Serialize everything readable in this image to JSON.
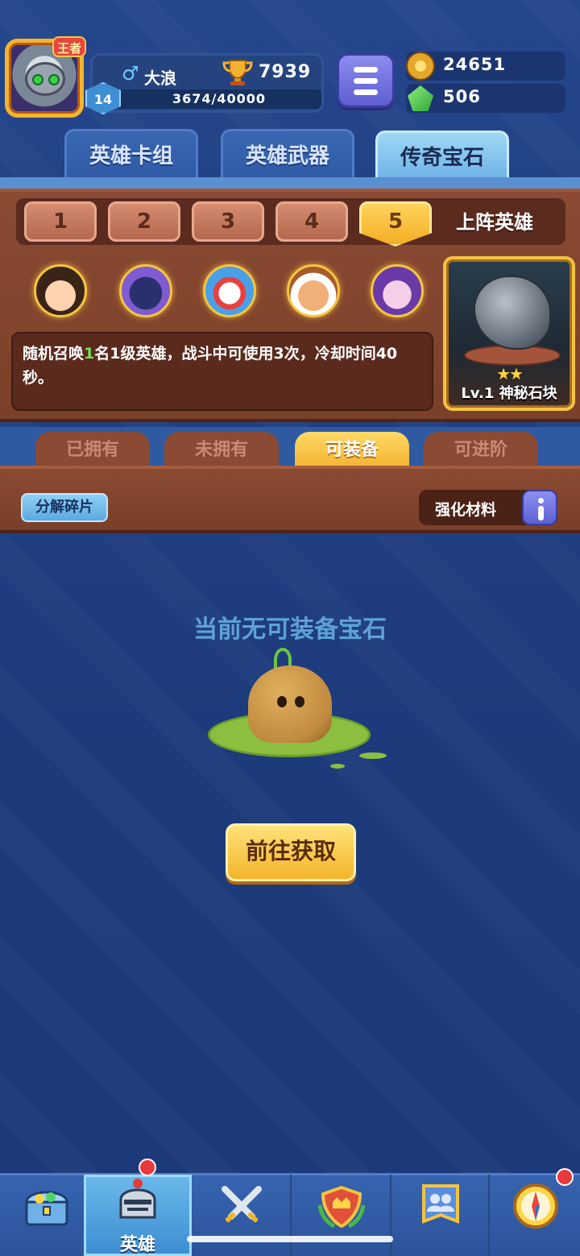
{
  "player": {
    "name": "大浪",
    "gender_symbol": "♂",
    "level": "14",
    "trophies": "7939",
    "xp": "3674/40000",
    "avatar_badge": "王者"
  },
  "currency": {
    "gold": "24651",
    "gems": "506"
  },
  "main_tabs": [
    {
      "label": "英雄卡组",
      "active": false
    },
    {
      "label": "英雄武器",
      "active": false
    },
    {
      "label": "传奇宝石",
      "active": true
    }
  ],
  "deck": {
    "slots": [
      "1",
      "2",
      "3",
      "4",
      "5"
    ],
    "active_slot": "5",
    "label": "上阵英雄"
  },
  "heroes": [
    {
      "icon": "hero-ninja-icon"
    },
    {
      "icon": "hero-knight-icon"
    },
    {
      "icon": "hero-clown-icon"
    },
    {
      "icon": "hero-chef-icon"
    },
    {
      "icon": "hero-mage-icon"
    }
  ],
  "description": {
    "part1": "随机召唤",
    "highlight": "1",
    "part2": "名1级英雄，战斗中可使用3次，冷却时间40秒。"
  },
  "gem_card": {
    "stars": "★★",
    "name": "Lv.1 神秘石块"
  },
  "filter_tabs": [
    {
      "label": "已拥有",
      "active": false
    },
    {
      "label": "未拥有",
      "active": false
    },
    {
      "label": "可装备",
      "active": true
    },
    {
      "label": "可进阶",
      "active": false
    }
  ],
  "toolbar": {
    "decompose_label": "分解碎片",
    "material_label": "强化材料"
  },
  "empty_state": {
    "title": "当前无可装备宝石",
    "button_label": "前往获取"
  },
  "bottom_nav": [
    {
      "icon": "treasure-chest-icon",
      "label": ""
    },
    {
      "icon": "knight-helmet-icon",
      "label": "英雄",
      "active": true
    },
    {
      "icon": "crossed-swords-icon",
      "label": ""
    },
    {
      "icon": "guild-shield-icon",
      "label": ""
    },
    {
      "icon": "friends-banner-icon",
      "label": ""
    },
    {
      "icon": "compass-icon",
      "label": ""
    }
  ],
  "colors": {
    "background": "#1f3c7e",
    "wood": "#8a4a33",
    "accent_yellow": "#f4b22f",
    "highlight_green": "#74e25a"
  }
}
